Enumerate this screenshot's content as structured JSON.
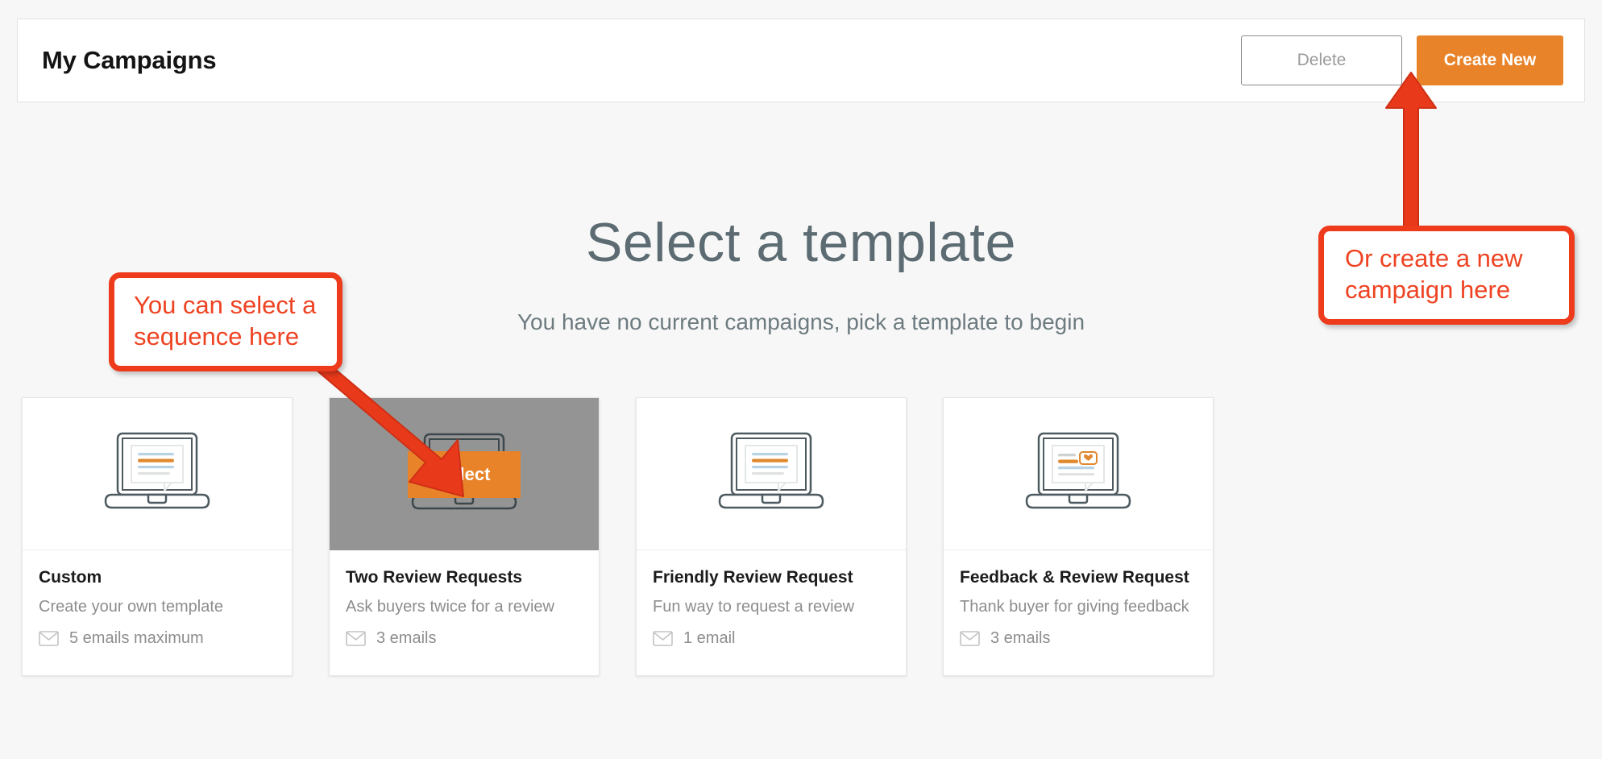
{
  "header": {
    "title": "My Campaigns",
    "delete_label": "Delete",
    "create_label": "Create New"
  },
  "hero": {
    "title": "Select a template",
    "subtitle": "You have no current campaigns, pick a template to begin"
  },
  "select_button_label": "Select",
  "cards": [
    {
      "name": "Custom",
      "description": "Create your own template",
      "emails": "5 emails maximum",
      "icon": "laptop-template-icon",
      "selected": false
    },
    {
      "name": "Two Review Requests",
      "description": "Ask buyers twice for a review",
      "emails": "3 emails",
      "icon": "laptop-template-icon",
      "selected": true
    },
    {
      "name": "Friendly Review Request",
      "description": "Fun way to request a review",
      "emails": "1 email",
      "icon": "laptop-template-icon",
      "selected": false
    },
    {
      "name": "Feedback & Review Request",
      "description": "Thank buyer for giving feedback",
      "emails": "3 emails",
      "icon": "laptop-template-heart-icon",
      "selected": false
    }
  ],
  "annotations": {
    "left": "You can select a sequence here",
    "right": "Or create a new campaign here"
  },
  "colors": {
    "accent_orange": "#e8832a",
    "annotation_red": "#ed3b1c",
    "page_background": "#f7f7f7",
    "overlay_gray": "#949494",
    "heading_slate": "#5c6c72"
  }
}
